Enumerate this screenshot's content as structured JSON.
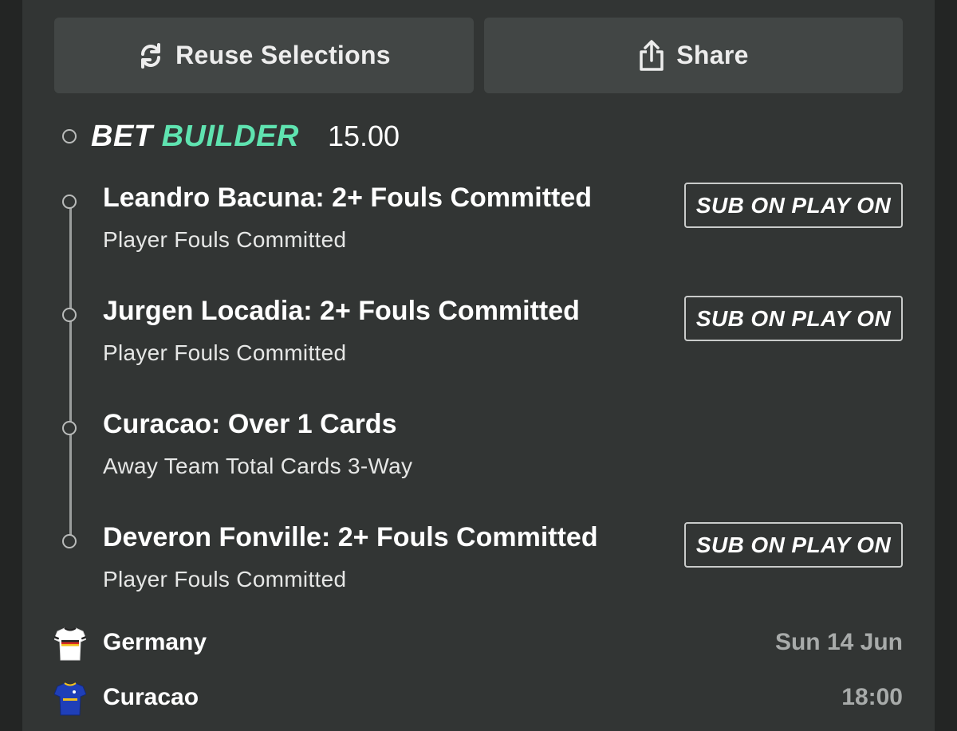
{
  "actions": {
    "reuse_label": "Reuse Selections",
    "share_label": "Share"
  },
  "bet": {
    "logo_word1": "BET",
    "logo_word2": "BUILDER",
    "odds": "15.00",
    "legs": [
      {
        "title": "Leandro Bacuna: 2+ Fouls Committed",
        "market": "Player Fouls Committed",
        "badge": "SUB ON PLAY ON"
      },
      {
        "title": "Jurgen Locadia: 2+ Fouls Committed",
        "market": "Player Fouls Committed",
        "badge": "SUB ON PLAY ON"
      },
      {
        "title": "Curacao: Over 1 Cards",
        "market": "Away Team Total Cards 3-Way",
        "badge": ""
      },
      {
        "title": "Deveron Fonville: 2+ Fouls Committed",
        "market": "Player Fouls Committed",
        "badge": "SUB ON PLAY ON"
      }
    ]
  },
  "match": {
    "home": {
      "name": "Germany",
      "meta": "Sun 14 Jun",
      "icon": "germany-shirt-icon"
    },
    "away": {
      "name": "Curacao",
      "meta": "18:00",
      "icon": "curacao-shirt-icon"
    }
  },
  "colors": {
    "background": "#323534",
    "button": "#424645",
    "accent_green": "#5fe3b0",
    "muted_text": "#a8abaa"
  }
}
